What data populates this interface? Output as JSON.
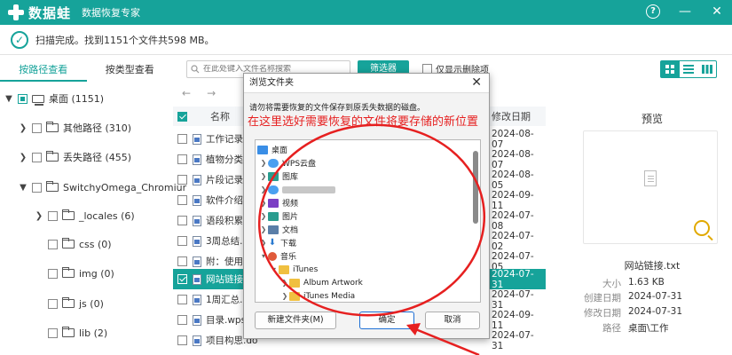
{
  "app": {
    "name": "数据蛙",
    "subtitle": "数据恢复专家",
    "colors": {
      "accent": "#16a39a",
      "annotation": "#e62020"
    }
  },
  "window_controls": {
    "help": "?",
    "minimize": "—",
    "close": "✕"
  },
  "status": {
    "text": "扫描完成。找到1151个文件共598 MB。"
  },
  "tabs": [
    {
      "label": "按路径查看",
      "active": true
    },
    {
      "label": "按类型查看",
      "active": false
    }
  ],
  "search": {
    "placeholder": "在此处键入文件名称搜索"
  },
  "filter_button": "筛选器",
  "only_deleted": "仅显示删除项",
  "tree": [
    {
      "label": "桌面 (1151)"
    },
    {
      "label": "其他路径 (310)"
    },
    {
      "label": "丢失路径 (455)"
    },
    {
      "label": "SwitchyOmega_Chromiur"
    },
    {
      "label": "_locales (6)"
    },
    {
      "label": "css (0)"
    },
    {
      "label": "img (0)"
    },
    {
      "label": "js (0)"
    },
    {
      "label": "lib (2)"
    }
  ],
  "list": {
    "headers": {
      "name": "名称",
      "date": "修改日期"
    },
    "rows": [
      {
        "name": "工作记录表",
        "date": "2024-08-07"
      },
      {
        "name": "植物分类.d",
        "date": "2024-08-07"
      },
      {
        "name": "片段记录.d",
        "date": "2024-08-05"
      },
      {
        "name": "软件介绍 -",
        "date": "2024-09-11"
      },
      {
        "name": "语段积累.d",
        "date": "2024-07-08"
      },
      {
        "name": "3周总结.do",
        "date": "2024-07-02"
      },
      {
        "name": "附：使用注",
        "date": "2024-07-05"
      },
      {
        "name": "网站链接.t",
        "date": "2024-07-31",
        "selected": true
      },
      {
        "name": "1周汇总.do",
        "date": "2024-07-31"
      },
      {
        "name": "目录.wps",
        "date": "2024-09-11"
      },
      {
        "name": "项目构思.do",
        "date": "2024-07-31"
      }
    ]
  },
  "preview": {
    "title": "预览",
    "filename": "网站链接.txt",
    "meta": [
      {
        "key": "大小",
        "value": "1.63 KB"
      },
      {
        "key": "创建日期",
        "value": "2024-07-31"
      },
      {
        "key": "修改日期",
        "value": "2024-07-31"
      },
      {
        "key": "路径",
        "value": "桌面\\工作"
      }
    ]
  },
  "dialog": {
    "title": "浏览文件夹",
    "close": "✕",
    "description": "请勿将需要恢复的文件保存到原丢失数据的磁盘。",
    "annotation": "在这里选好需要恢复的文件将要存储的新位置",
    "items": [
      {
        "label": "桌面",
        "icon": "desktop-icon"
      },
      {
        "label": "WPS云盘",
        "icon": "cloud-icon"
      },
      {
        "label": "图库",
        "icon": "gallery-icon"
      },
      {
        "label": "",
        "icon": "user-folder-icon",
        "blurred": true
      },
      {
        "label": "视频",
        "icon": "video-icon"
      },
      {
        "label": "图片",
        "icon": "pictures-icon"
      },
      {
        "label": "文档",
        "icon": "documents-icon"
      },
      {
        "label": "下载",
        "icon": "download-icon"
      },
      {
        "label": "音乐",
        "icon": "music-icon"
      },
      {
        "label": "iTunes",
        "icon": "folder-icon"
      },
      {
        "label": "Album Artwork",
        "icon": "folder-icon"
      },
      {
        "label": "iTunes Media",
        "icon": "folder-icon"
      }
    ],
    "buttons": {
      "new_folder": "新建文件夹(M)",
      "ok": "确定",
      "cancel": "取消"
    }
  }
}
